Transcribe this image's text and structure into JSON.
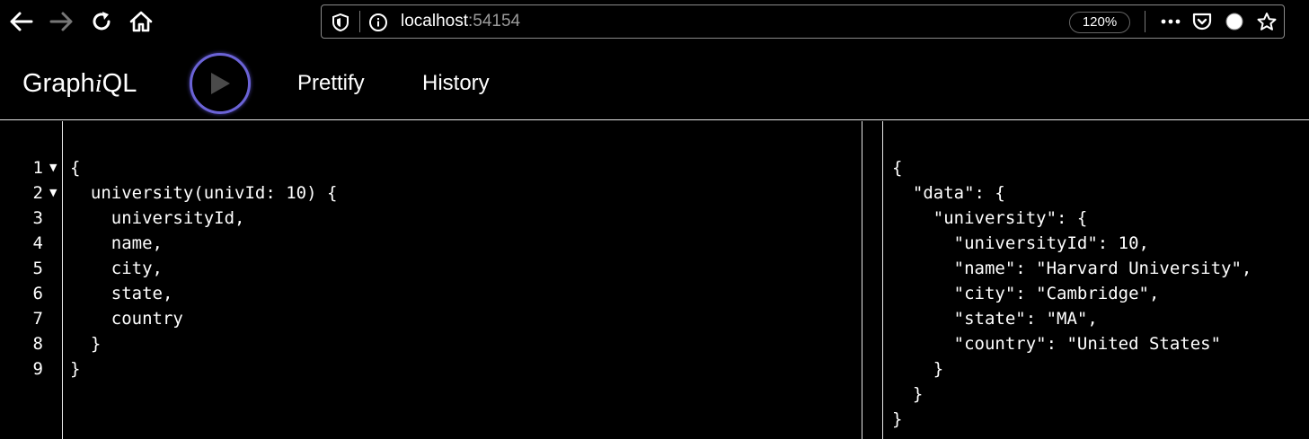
{
  "browser": {
    "url_host": "localhost",
    "url_port": ":54154",
    "zoom": "120%"
  },
  "toolbar": {
    "logo_prefix": "Graph",
    "logo_i": "i",
    "logo_suffix": "QL",
    "prettify_label": "Prettify",
    "history_label": "History"
  },
  "query": {
    "line_numbers": [
      "1",
      "2",
      "3",
      "4",
      "5",
      "6",
      "7",
      "8",
      "9"
    ],
    "lines": [
      "{",
      "  university(univId: 10) {",
      "    universityId,",
      "    name,",
      "    city,",
      "    state,",
      "    country",
      "  }",
      "}"
    ]
  },
  "result": {
    "lines": [
      "{",
      "  \"data\": {",
      "    \"university\": {",
      "      \"universityId\": 10,",
      "      \"name\": \"Harvard University\",",
      "      \"city\": \"Cambridge\",",
      "      \"state\": \"MA\",",
      "      \"country\": \"United States\"",
      "    }",
      "  }",
      "}"
    ]
  },
  "icons": {
    "back": "arrow-left-icon",
    "forward": "arrow-right-icon",
    "reload": "reload-icon",
    "home": "home-icon",
    "shield": "shield-icon",
    "info": "info-icon",
    "more": "more-icon",
    "pocket": "pocket-icon",
    "extension": "circle-icon",
    "bookmark": "star-icon",
    "execute": "play-icon",
    "fold": "fold-arrow-icon"
  },
  "colors": {
    "background": "#000000",
    "text": "#ffffff",
    "accent": "#6b63d6",
    "border": "#e6e6e6"
  }
}
